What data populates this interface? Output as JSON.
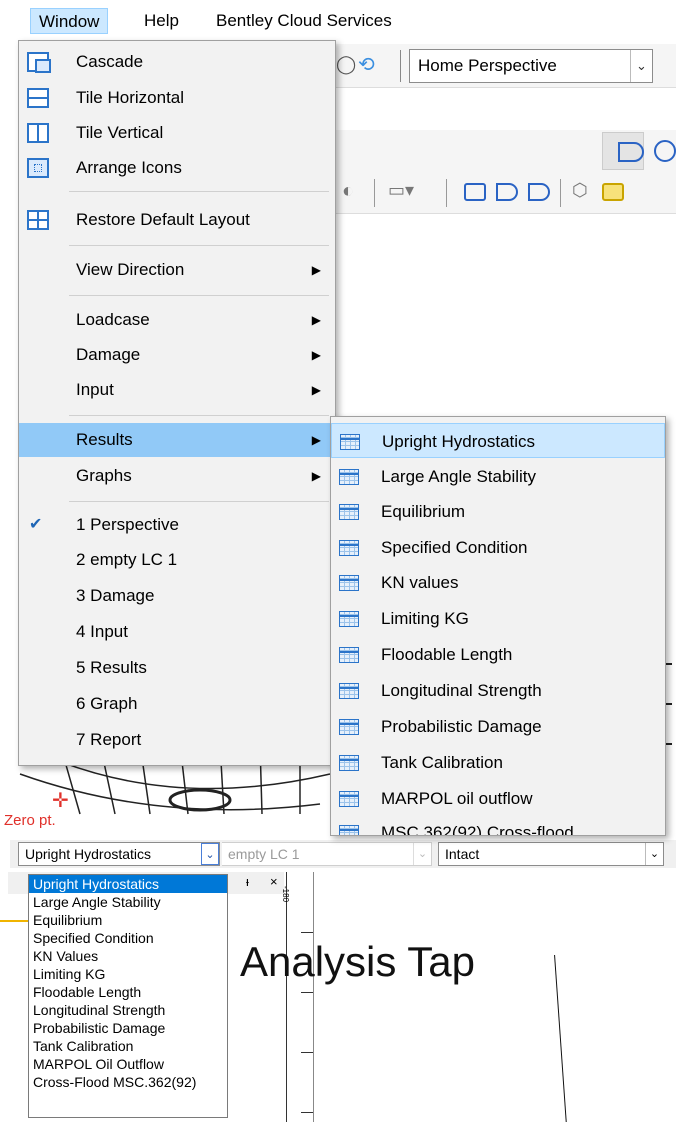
{
  "menubar": {
    "window": "Window",
    "help": "Help",
    "bentley": "Bentley Cloud Services"
  },
  "toolbar": {
    "perspective_select": "Home Perspective"
  },
  "window_menu": {
    "cascade": "Cascade",
    "tile_horizontal": "Tile Horizontal",
    "tile_vertical": "Tile Vertical",
    "arrange_icons": "Arrange Icons",
    "restore_default_layout": "Restore Default Layout",
    "view_direction": "View Direction",
    "loadcase": "Loadcase",
    "damage": "Damage",
    "input": "Input",
    "results": "Results",
    "graphs": "Graphs",
    "win1": "1 Perspective",
    "win2": "2 empty LC 1",
    "win3": "3 Damage",
    "win4": "4 Input",
    "win5": "5 Results",
    "win6": "6 Graph",
    "win7": "7 Report"
  },
  "results_submenu": [
    "Upright Hydrostatics",
    "Large Angle Stability",
    "Equilibrium",
    "Specified Condition",
    "KN values",
    "Limiting KG",
    "Floodable Length",
    "Longitudinal Strength",
    "Probabilistic Damage",
    "Tank Calibration",
    "MARPOL oil outflow",
    "MSC 362(92) Cross-flood"
  ],
  "viewport": {
    "zero_pt": "Zero pt."
  },
  "analysis_bar": {
    "analysis_type": "Upright Hydrostatics",
    "loadcase": "empty LC 1",
    "damage_case": "Intact"
  },
  "dock": {
    "pin": "ᵻ",
    "close": "×",
    "ruler_label": "-180"
  },
  "analysis_dropdown": [
    "Upright Hydrostatics",
    "Large Angle Stability",
    "Equilibrium",
    "Specified Condition",
    "KN Values",
    "Limiting KG",
    "Floodable Length",
    "Longitudinal Strength",
    "Probabilistic Damage",
    "Tank Calibration",
    "MARPOL Oil Outflow",
    "Cross-Flood MSC.362(92)"
  ],
  "annotation": {
    "label": "Analysis Tap"
  }
}
